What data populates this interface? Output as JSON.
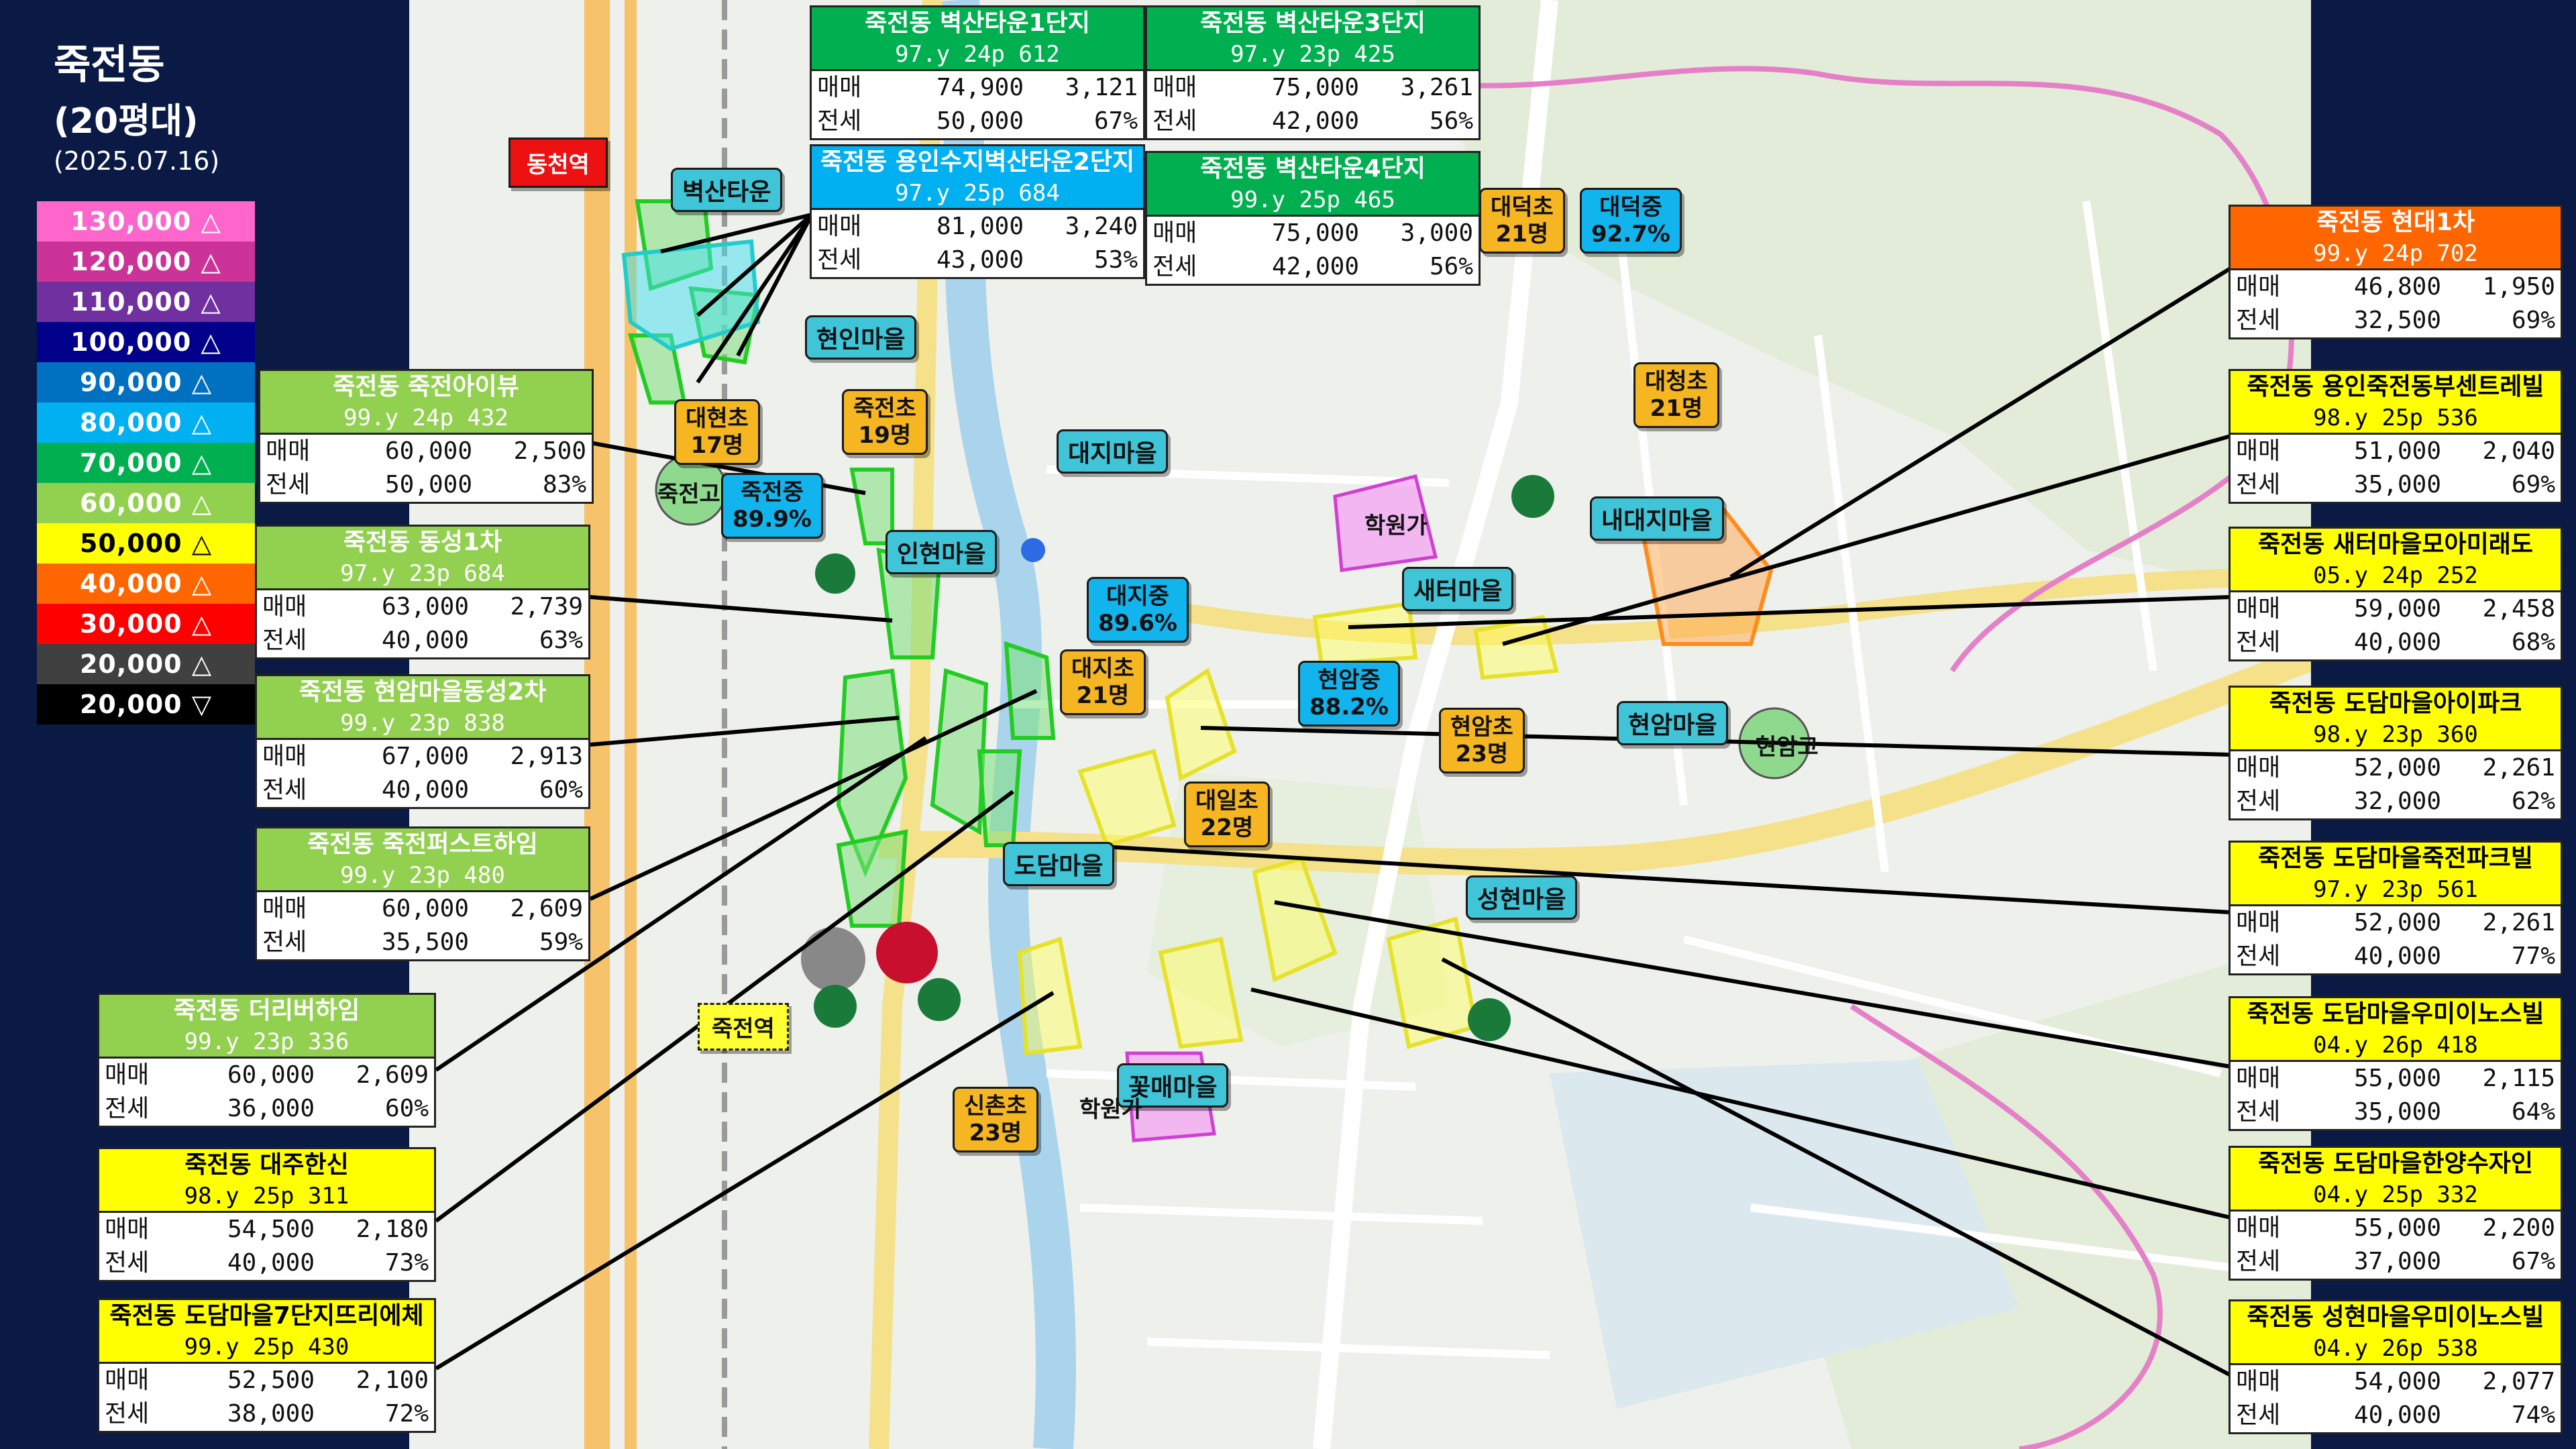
{
  "title": {
    "line1": "죽전동",
    "line2": "(20평대)",
    "date": "(2025.07.16)"
  },
  "legend": [
    {
      "label": "130,000 △",
      "color": "#ff66cc"
    },
    {
      "label": "120,000 △",
      "color": "#cc3399"
    },
    {
      "label": "110,000 △",
      "color": "#7030a0"
    },
    {
      "label": "100,000 △",
      "color": "#00008b"
    },
    {
      "label": "90,000 △",
      "color": "#0070c0"
    },
    {
      "label": "80,000 △",
      "color": "#00b0f0"
    },
    {
      "label": "70,000 △",
      "color": "#00b050"
    },
    {
      "label": "60,000 △",
      "color": "#92d050"
    },
    {
      "label": "50,000 △",
      "color": "#ffff00",
      "text": "#000000"
    },
    {
      "label": "40,000 △",
      "color": "#ff6600"
    },
    {
      "label": "30,000 △",
      "color": "#ff0000"
    },
    {
      "label": "20,000 △",
      "color": "#404040"
    },
    {
      "label": "20,000 ▽",
      "color": "#000000"
    }
  ],
  "row_labels": {
    "sale": "매매",
    "rent": "전세"
  },
  "boxes": [
    {
      "name": "죽전동 벽산타운1단지",
      "sub": "97.y 24p 612",
      "sale": "74,900",
      "sale_pp": "3,121",
      "rent": "50,000",
      "ratio": "67%",
      "color": "#00b050",
      "text": "#ffffff"
    },
    {
      "name": "죽전동 벽산타운3단지",
      "sub": "97.y 23p 425",
      "sale": "75,000",
      "sale_pp": "3,261",
      "rent": "42,000",
      "ratio": "56%",
      "color": "#00b050",
      "text": "#ffffff"
    },
    {
      "name": "죽전동 용인수지벽산타운2단지",
      "sub": "97.y 25p 684",
      "sale": "81,000",
      "sale_pp": "3,240",
      "rent": "43,000",
      "ratio": "53%",
      "color": "#00b0f0",
      "text": "#ffffff"
    },
    {
      "name": "죽전동 벽산타운4단지",
      "sub": "99.y 25p 465",
      "sale": "75,000",
      "sale_pp": "3,000",
      "rent": "42,000",
      "ratio": "56%",
      "color": "#00b050",
      "text": "#ffffff"
    },
    {
      "name": "죽전동 죽전아이뷰",
      "sub": "99.y 24p 432",
      "sale": "60,000",
      "sale_pp": "2,500",
      "rent": "50,000",
      "ratio": "83%",
      "color": "#92d050",
      "text": "#ffffff"
    },
    {
      "name": "죽전동 동성1차",
      "sub": "97.y 23p 684",
      "sale": "63,000",
      "sale_pp": "2,739",
      "rent": "40,000",
      "ratio": "63%",
      "color": "#92d050",
      "text": "#ffffff"
    },
    {
      "name": "죽전동 현암마을동성2차",
      "sub": "99.y 23p 838",
      "sale": "67,000",
      "sale_pp": "2,913",
      "rent": "40,000",
      "ratio": "60%",
      "color": "#92d050",
      "text": "#ffffff"
    },
    {
      "name": "죽전동 죽전퍼스트하임",
      "sub": "99.y 23p 480",
      "sale": "60,000",
      "sale_pp": "2,609",
      "rent": "35,500",
      "ratio": "59%",
      "color": "#92d050",
      "text": "#ffffff"
    },
    {
      "name": "죽전동 더리버하임",
      "sub": "99.y 23p 336",
      "sale": "60,000",
      "sale_pp": "2,609",
      "rent": "36,000",
      "ratio": "60%",
      "color": "#92d050",
      "text": "#ffffff"
    },
    {
      "name": "죽전동 대주한신",
      "sub": "98.y 25p 311",
      "sale": "54,500",
      "sale_pp": "2,180",
      "rent": "40,000",
      "ratio": "73%",
      "color": "#ffff00",
      "text": "#000000"
    },
    {
      "name": "죽전동 도담마을7단지뜨리에체",
      "sub": "99.y 25p 430",
      "sale": "52,500",
      "sale_pp": "2,100",
      "rent": "38,000",
      "ratio": "72%",
      "color": "#ffff00",
      "text": "#000000"
    },
    {
      "name": "죽전동 현대1차",
      "sub": "99.y 24p 702",
      "sale": "46,800",
      "sale_pp": "1,950",
      "rent": "32,500",
      "ratio": "69%",
      "color": "#ff6600",
      "text": "#ffffff"
    },
    {
      "name": "죽전동 용인죽전동부센트레빌",
      "sub": "98.y 25p 536",
      "sale": "51,000",
      "sale_pp": "2,040",
      "rent": "35,000",
      "ratio": "69%",
      "color": "#ffff00",
      "text": "#000000"
    },
    {
      "name": "죽전동 새터마을모아미래도",
      "sub": "05.y 24p 252",
      "sale": "59,000",
      "sale_pp": "2,458",
      "rent": "40,000",
      "ratio": "68%",
      "color": "#ffff00",
      "text": "#000000"
    },
    {
      "name": "죽전동 도담마을아이파크",
      "sub": "98.y 23p 360",
      "sale": "52,000",
      "sale_pp": "2,261",
      "rent": "32,000",
      "ratio": "62%",
      "color": "#ffff00",
      "text": "#000000"
    },
    {
      "name": "죽전동 도담마을죽전파크빌",
      "sub": "97.y 23p 561",
      "sale": "52,000",
      "sale_pp": "2,261",
      "rent": "40,000",
      "ratio": "77%",
      "color": "#ffff00",
      "text": "#000000"
    },
    {
      "name": "죽전동 도담마을우미이노스빌",
      "sub": "04.y 26p 418",
      "sale": "55,000",
      "sale_pp": "2,115",
      "rent": "35,000",
      "ratio": "64%",
      "color": "#ffff00",
      "text": "#000000"
    },
    {
      "name": "죽전동 도담마을한양수자인",
      "sub": "04.y 25p 332",
      "sale": "55,000",
      "sale_pp": "2,200",
      "rent": "37,000",
      "ratio": "67%",
      "color": "#ffff00",
      "text": "#000000"
    },
    {
      "name": "죽전동 성현마을우미이노스빌",
      "sub": "04.y 26p 538",
      "sale": "54,000",
      "sale_pp": "2,077",
      "rent": "40,000",
      "ratio": "74%",
      "color": "#ffff00",
      "text": "#000000"
    }
  ],
  "labels": {
    "station_dongcheon": "동천역",
    "station_jukjeon": "죽전역",
    "byeoksan": "벽산타운",
    "hyeonin": "현인마을",
    "inhyeon": "인현마을",
    "daeji_village": "대지마을",
    "naedaeji": "내대지마을",
    "saeteo": "새터마을",
    "hyeonam": "현암마을",
    "dodam": "도담마을",
    "seonghyeon": "성현마을",
    "kkotmae": "꽃매마을",
    "school_daehyeon": "대현초\n17명",
    "school_jukjeon_el": "죽전초\n19명",
    "school_daedeok": "대덕초\n21명",
    "school_daedeok_mid": "대덕중\n92.7%",
    "school_daecheong": "대청초\n21명",
    "school_daeji_mid": "대지중\n89.6%",
    "school_daeji_el": "대지초\n21명",
    "school_hyeonam_mid": "현암중\n88.2%",
    "school_hyeonam_el": "현암초\n23명",
    "school_dail": "대일초\n22명",
    "school_sinchon": "신촌초\n23명",
    "school_jukjeon_mid": "죽전중\n89.9%",
    "school_jukjeon_high": "죽전고",
    "school_hyeonam_high": "현암고",
    "academy1": "학원가",
    "academy2": "학원가"
  }
}
